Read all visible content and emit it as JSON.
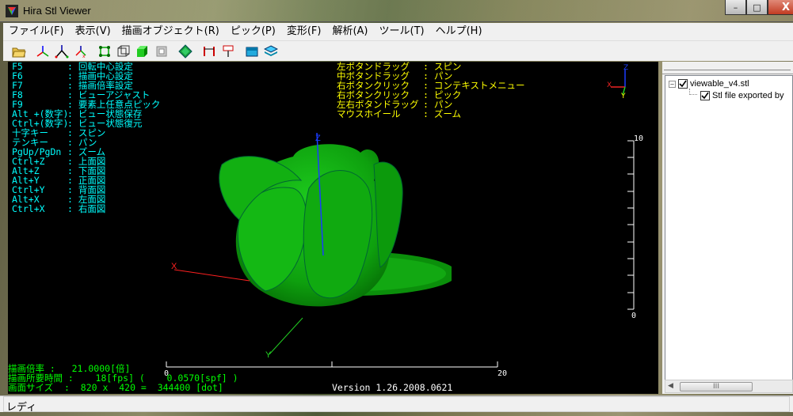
{
  "window": {
    "title": "Hira Stl Viewer",
    "buttons": {
      "minimize": "–",
      "maximize": "□",
      "close": "X"
    }
  },
  "menu": [
    "ファイル(F)",
    "表示(V)",
    "描画オブジェクト(R)",
    "ピック(P)",
    "変形(F)",
    "解析(A)",
    "ツール(T)",
    "ヘルプ(H)"
  ],
  "toolbar": {
    "icons": [
      "open-folder-icon",
      "axis-icon",
      "axis-xyz-icon",
      "axis-red-icon",
      "vertex-select-icon",
      "wireframe-icon",
      "solid-green-icon",
      "box-icon",
      "diamond-icon",
      "measure-icon",
      "pin-icon",
      "cyan-view-icon",
      "layers-icon"
    ]
  },
  "viewport": {
    "key_help_keys": "F5\nF6\nF7\nF8\nF9\nAlt +(数字)\nCtrl+(数字)\n十字キー\nテンキー\nPgUp/PgDn\nCtrl+Z\nAlt+Z\nAlt+Y\nCtrl+Y\nAlt+X\nCtrl+X",
    "key_help_values": ": 回転中心設定\n: 描画中心設定\n: 描画倍率設定\n: ビューアジャスト\n: 要素上任意点ピック\n: ビュー状態保存\n: ビュー状態復元\n: スピン\n: パン\n: ズーム\n: 上面図\n: 下面図\n: 正面図\n: 背面図\n: 左面図\n: 右面図",
    "mouse_help_keys": "左ボタンドラッグ\n中ボタンドラッグ\n右ボタンクリック\n右ボタンクリック\n左右ボタンドラッグ\nマウスホイール",
    "mouse_help_values": ": スピン\n: パン\n: コンテキストメニュー\n: ピック\n: パン\n: ズーム",
    "stats": "描画倍率 :   21.0000[倍]\n描画所要時間 :    18[fps] (    0.0570[spf] )\n画面サイズ  :  820 x  420 =  344400 [dot]",
    "version": "Version 1.26.2008.0621",
    "ruler_v_top": "10",
    "ruler_v_bottom": "0",
    "ruler_h_left": "0",
    "ruler_h_right": "20",
    "axis_labels": {
      "x": "X",
      "y": "Y",
      "z": "Z"
    }
  },
  "tree": {
    "root": {
      "label": "viewable_v4.stl",
      "expander": "–",
      "checked": true
    },
    "child": {
      "label": "Stl file exported by ",
      "checked": true
    }
  },
  "scroll": {
    "thumb": "III"
  },
  "status": {
    "text": "レディ"
  }
}
